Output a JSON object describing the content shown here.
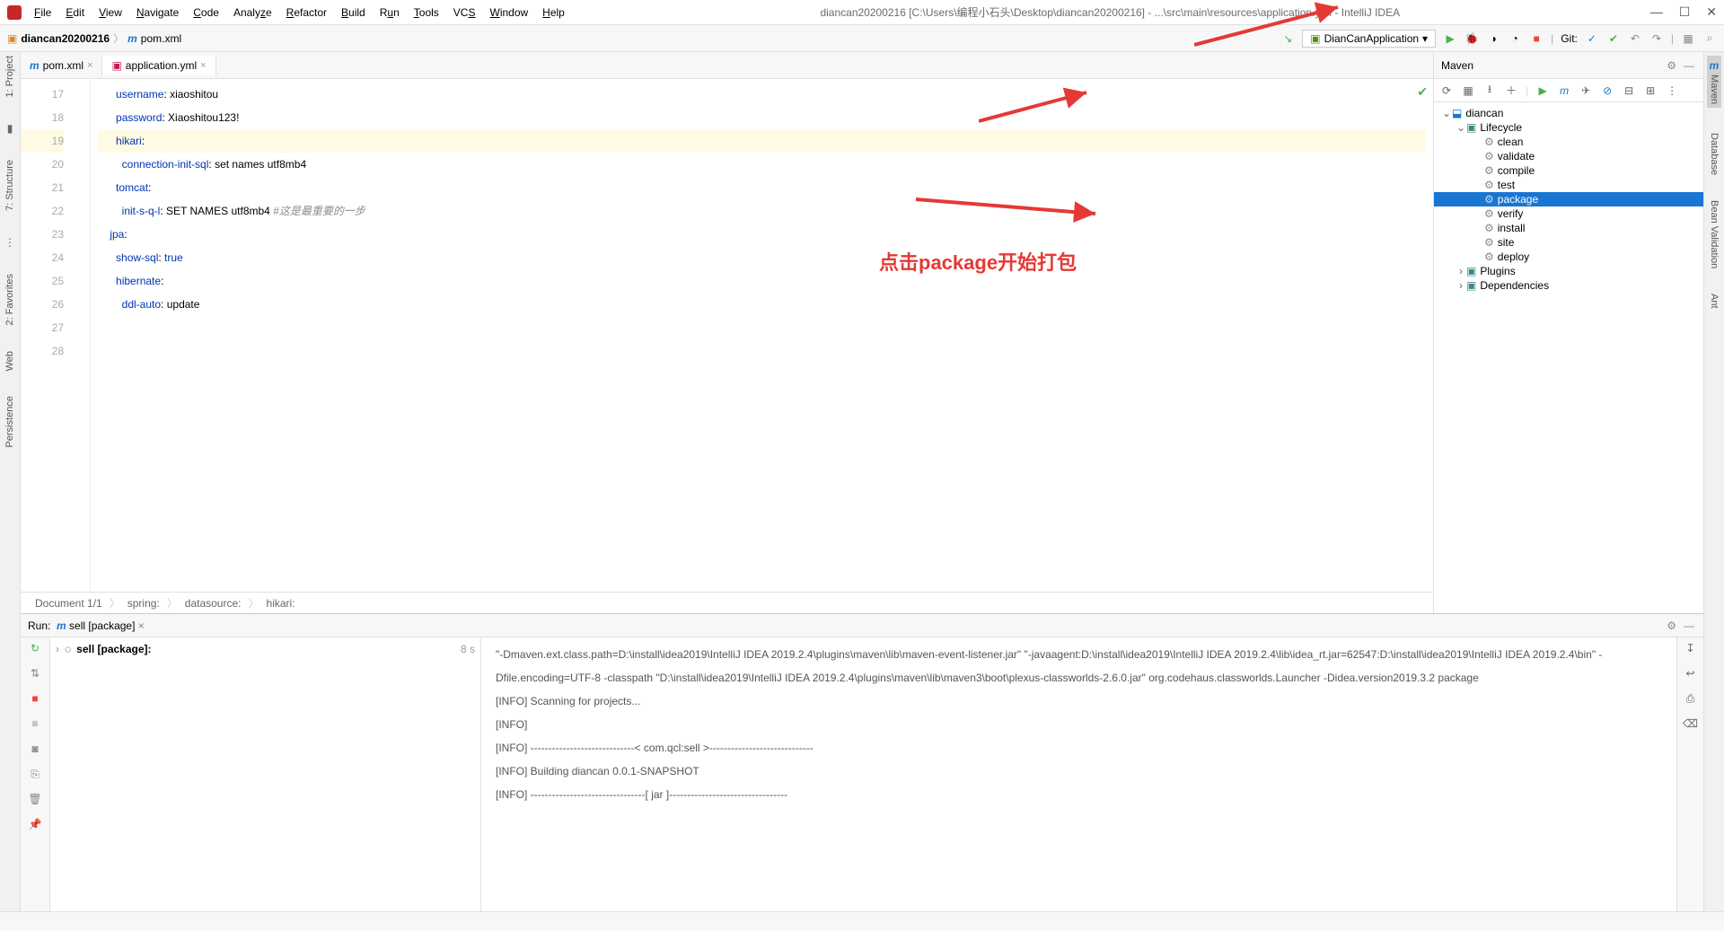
{
  "menus": [
    "File",
    "Edit",
    "View",
    "Navigate",
    "Code",
    "Analyze",
    "Refactor",
    "Build",
    "Run",
    "Tools",
    "VCS",
    "Window",
    "Help"
  ],
  "window_title": "diancan20200216 [C:\\Users\\编程小石头\\Desktop\\diancan20200216] - ...\\src\\main\\resources\\application.yml - IntelliJ IDEA",
  "crumb": {
    "project": "diancan20200216",
    "file": "pom.xml"
  },
  "run_config": "DianCanApplication",
  "git_label": "Git:",
  "editor_tabs": [
    {
      "name": "pom.xml"
    },
    {
      "name": "application.yml"
    }
  ],
  "lines": {
    "17": {
      "pre": "      ",
      "key": "username",
      "sep": ": ",
      "val": "xiaoshitou"
    },
    "18": {
      "pre": "      ",
      "key": "password",
      "sep": ": ",
      "val": "Xiaoshitou123!"
    },
    "19": {
      "pre": "      ",
      "key": "hikari",
      "sep": ":",
      "val": ""
    },
    "20": {
      "pre": "        ",
      "key": "connection-init-sql",
      "sep": ": ",
      "val": "set names utf8mb4"
    },
    "21": {
      "pre": "      ",
      "key": "tomcat",
      "sep": ":",
      "val": ""
    },
    "22": {
      "pre": "        ",
      "key": "init-s-q-l",
      "sep": ": ",
      "val": "SET NAMES utf8mb4 ",
      "comment": "#这是最重要的一步"
    },
    "23": {
      "pre": "    ",
      "key": "jpa",
      "sep": ":",
      "val": ""
    },
    "24": {
      "pre": "      ",
      "key": "show-sql",
      "sep": ": ",
      "val": "true"
    },
    "25": {
      "pre": "      ",
      "key": "hibernate",
      "sep": ":",
      "val": ""
    },
    "26": {
      "pre": "        ",
      "key": "ddl-auto",
      "sep": ": ",
      "val": "update"
    }
  },
  "gutter": [
    "17",
    "18",
    "19",
    "20",
    "21",
    "22",
    "23",
    "24",
    "25",
    "26",
    "27",
    "28"
  ],
  "status": {
    "doc": "Document 1/1",
    "p1": "spring:",
    "p2": "datasource:",
    "p3": "hikari:"
  },
  "maven_title": "Maven",
  "maven_tree": {
    "root": "diancan",
    "lifecycle_label": "Lifecycle",
    "life": [
      "clean",
      "validate",
      "compile",
      "test",
      "package",
      "verify",
      "install",
      "site",
      "deploy"
    ],
    "plugins": "Plugins",
    "deps": "Dependencies"
  },
  "run": {
    "label": "Run:",
    "target": "sell [package]",
    "tree_item": "sell [package]:",
    "time": "8 s",
    "out": [
      "\"-Dmaven.ext.class.path=D:\\install\\idea2019\\IntelliJ IDEA 2019.2.4\\plugins\\maven\\lib\\maven-event-listener.jar\" \"-javaagent:D:\\install\\idea2019\\IntelliJ IDEA 2019.2.4\\lib\\idea_rt.jar=62547:D:\\install\\idea2019\\IntelliJ IDEA 2019.2.4\\bin\" -Dfile.encoding=UTF-8 -classpath \"D:\\install\\idea2019\\IntelliJ IDEA 2019.2.4\\plugins\\maven\\lib\\maven3\\boot\\plexus-classworlds-2.6.0.jar\" org.codehaus.classworlds.Launcher -Didea.version2019.3.2 package",
      "[INFO] Scanning for projects...",
      "[INFO] ",
      "[INFO] -----------------------------< com.qcl:sell >-----------------------------",
      "[INFO] Building diancan 0.0.1-SNAPSHOT",
      "[INFO] --------------------------------[ jar ]---------------------------------"
    ]
  },
  "annot": "点击package开始打包"
}
